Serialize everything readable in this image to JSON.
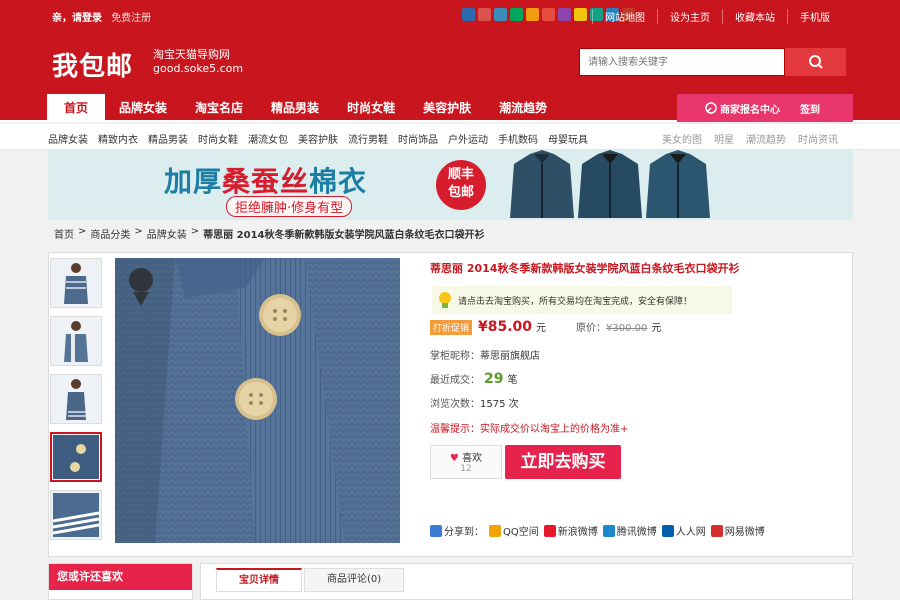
{
  "topbar": {
    "greeting": "亲，请登录",
    "register": "免费注册",
    "links": [
      "网站地图",
      "设为主页",
      "收藏本站",
      "手机版"
    ],
    "icon_colors": [
      "#2b6cb0",
      "#d9534f",
      "#3c8dbc",
      "#00a65a",
      "#f39c12",
      "#e74c3c",
      "#8e44ad",
      "#f1c40f",
      "#16a085",
      "#2980b9",
      "#c0392b"
    ]
  },
  "header": {
    "logo": "我包邮",
    "tagline_cn": "淘宝天猫导购网",
    "tagline_en": "good.soke5.com",
    "search_placeholder": "请输入搜索关键字"
  },
  "nav": {
    "items": [
      "首页",
      "品牌女装",
      "淘宝名店",
      "精品男装",
      "时尚女鞋",
      "美容护肤",
      "潮流趋势"
    ],
    "merchant": "商家报名中心",
    "signin": "签到"
  },
  "subnav": {
    "left": [
      "品牌女装",
      "精致内衣",
      "精品男装",
      "时尚女鞋",
      "潮流女包",
      "美容护肤",
      "流行男鞋",
      "时尚饰品",
      "户外运动",
      "手机数码",
      "母婴玩具"
    ],
    "right": [
      "美女的图",
      "明星",
      "潮流趋势",
      "时尚资讯"
    ]
  },
  "banner": {
    "title_a": "加厚",
    "title_b": "桑蚕丝",
    "title_c": "棉衣",
    "slogan": "拒绝臃肿·修身有型",
    "badge_line1": "顺丰",
    "badge_line2": "包邮"
  },
  "breadcrumb": [
    "首页",
    "商品分类",
    "品牌女装",
    "蒂思丽 2014秋冬季新款韩版女装学院风蓝白条纹毛衣口袋开衫"
  ],
  "product": {
    "title": "蒂思丽 2014秋冬季新款韩版女装学院风蓝白条纹毛衣口袋开衫",
    "notice": "请点击去淘宝购买，所有交易均在淘宝完成，安全有保障！",
    "price_tag": "打折促销",
    "price": "¥85.00",
    "price_unit": "元",
    "orig_label": "原价：",
    "orig_price": "¥300.00",
    "orig_unit": "元",
    "shop_label": "掌柜昵称：",
    "shop": "蒂思丽旗舰店",
    "sold_label": "最近成交：",
    "sold": "29",
    "sold_unit": "笔",
    "views_label": "浏览次数：",
    "views": "1575 次",
    "tip_label": "温馨提示：",
    "tip": "实际成交价以淘宝上的价格为准+",
    "like_label": "喜欢",
    "like_count": "12",
    "buy_label": "立即去购买",
    "share_label": "分享到：",
    "share": [
      {
        "name": "QQ空间",
        "color": "#f0a30a"
      },
      {
        "name": "新浪微博",
        "color": "#e6162d"
      },
      {
        "name": "腾讯微博",
        "color": "#1a88c9"
      },
      {
        "name": "人人网",
        "color": "#005eac"
      },
      {
        "name": "网易微博",
        "color": "#d32f2f"
      }
    ]
  },
  "bottom": {
    "guess": "您或许还喜欢",
    "tabs": [
      "宝贝详情",
      "商品评论(0)"
    ]
  }
}
